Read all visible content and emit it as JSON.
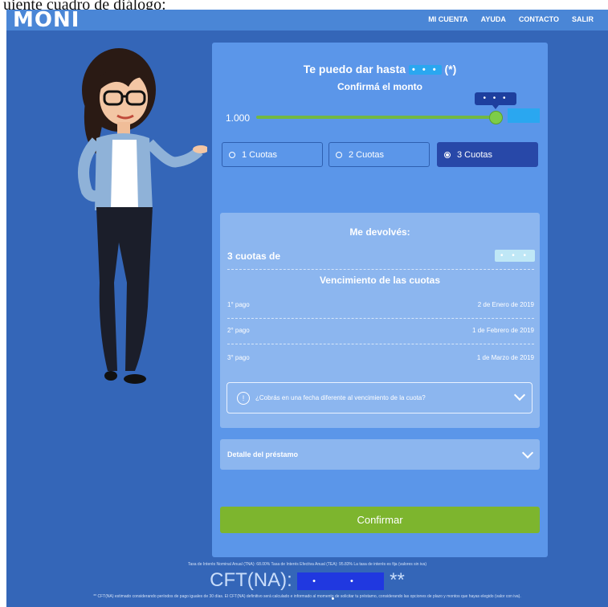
{
  "caption": "uiente cuadro de diálogo:",
  "header": {
    "logo": "MONI",
    "nav": [
      "MI CUENTA",
      "AYUDA",
      "CONTACTO",
      "SALIR"
    ]
  },
  "offer": {
    "prefix": "Te puedo dar hasta",
    "masked_value": "• • •",
    "suffix": "(*)",
    "confirm_label": "Confirmá el monto"
  },
  "slider": {
    "min_label": "1.000",
    "tooltip": "• • •",
    "level": 0.98
  },
  "quotas": {
    "options": [
      "1 Cuotas",
      "2 Cuotas",
      "3 Cuotas"
    ],
    "selected_index": 2
  },
  "returns": {
    "title": "Me devolvés:",
    "cuotas_label": "3 cuotas de",
    "cuotas_amount": "• • •",
    "vencimiento_title": "Vencimiento de las cuotas",
    "payments": [
      {
        "label": "1° pago",
        "date": "2 de Enero de 2019"
      },
      {
        "label": "2° pago",
        "date": "1 de Febrero de 2019"
      },
      {
        "label": "3° pago",
        "date": "1 de Marzo de 2019"
      }
    ],
    "question": "¿Cobrás en una fecha diferente al vencimiento de la cuota?"
  },
  "detail_label": "Detalle del préstamo",
  "confirm_button": "Confirmar",
  "footer": {
    "rates": "Tasa de Interés Nominal Anual (TNA): 68.00% Tasa de Interés Efectiva Anual (TEA): 95.83% La tasa de interés es fija (valores sin iva)",
    "cft_label": "CFT(NA):",
    "cft_mask": "• • •",
    "cft_suffix": "**",
    "note": "** CFT(NA) estimado considerando períodos de pago iguales de 30 días. El CFT(NA) definitivo será calculado e informado al momento de solicitar tu préstamo, considerando las opciones de plazo y montos que hayas elegido (valor con iva)."
  },
  "colors": {
    "background": "#3466b8",
    "panel": "#5b96e9",
    "accent_green": "#7db52e",
    "selected_quota": "#2848a8"
  }
}
